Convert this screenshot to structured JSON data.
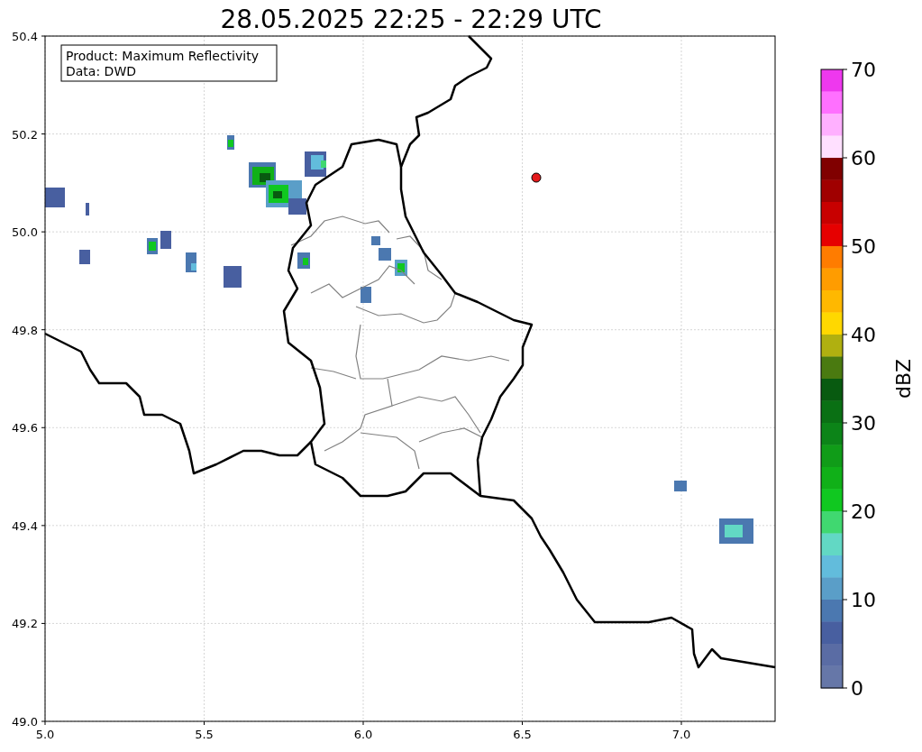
{
  "title": "28.05.2025 22:25 - 22:29 UTC",
  "legend": [
    "Product: Maximum Reflectivity",
    "Data: DWD"
  ],
  "map": {
    "xticks": [
      "5.0",
      "5.5",
      "6.0",
      "6.5",
      "7.0"
    ],
    "yticks": [
      "50.4",
      "50.2",
      "50.0",
      "49.8",
      "49.6",
      "49.4",
      "49.2",
      "49.0"
    ]
  },
  "colorbar": {
    "label": "dBZ",
    "ticks": [
      "70",
      "60",
      "50",
      "40",
      "30",
      "20",
      "10",
      "0"
    ],
    "segments": [
      {
        "color": "#ee38ee"
      },
      {
        "color": "#ff70ff"
      },
      {
        "color": "#ffb0ff"
      },
      {
        "color": "#ffe0ff"
      },
      {
        "color": "#800000"
      },
      {
        "color": "#a00000"
      },
      {
        "color": "#c80000"
      },
      {
        "color": "#e60000"
      },
      {
        "color": "#ff7c00"
      },
      {
        "color": "#ff9c00"
      },
      {
        "color": "#ffb800"
      },
      {
        "color": "#ffd800"
      },
      {
        "color": "#b0b010"
      },
      {
        "color": "#4a7a10"
      },
      {
        "color": "#085a10"
      },
      {
        "color": "#0a7014"
      },
      {
        "color": "#0c8418"
      },
      {
        "color": "#109c18"
      },
      {
        "color": "#10b018"
      },
      {
        "color": "#10c820"
      },
      {
        "color": "#40d870"
      },
      {
        "color": "#62d8c4"
      },
      {
        "color": "#62bcdc"
      },
      {
        "color": "#5a9ec8"
      },
      {
        "color": "#4b78b0"
      },
      {
        "color": "#485fa0"
      },
      {
        "color": "#5a6ca4"
      },
      {
        "color": "#6677a8"
      }
    ]
  }
}
